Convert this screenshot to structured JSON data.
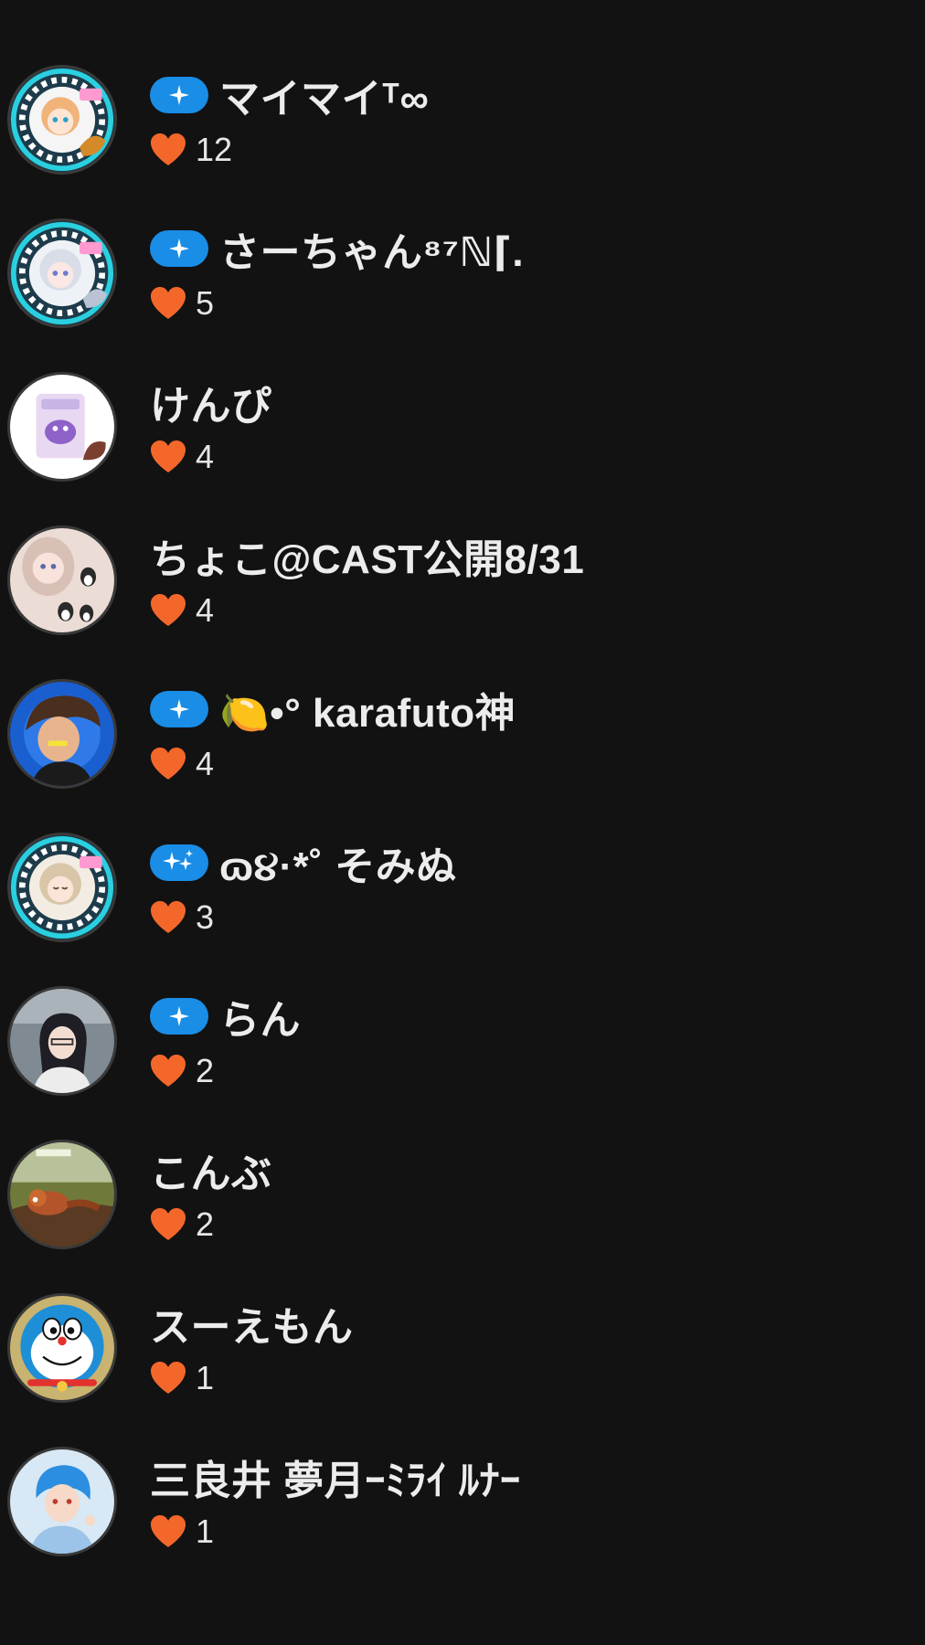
{
  "users": [
    {
      "name": "マイマイᵀ∞",
      "likes": "12",
      "badge": "sparkle",
      "avatar": "ticket-anime-girl-avatar"
    },
    {
      "name": "さーちゃん⁸⁷ℕ⌈.",
      "likes": "5",
      "badge": "sparkle",
      "avatar": "ticket-white-hair-girl-avatar"
    },
    {
      "name": "けんぴ",
      "likes": "4",
      "badge": "",
      "avatar": "snack-package-avatar"
    },
    {
      "name": "ちょこ@CAST公開8/31",
      "likes": "4",
      "badge": "",
      "avatar": "girl-with-penguins-avatar"
    },
    {
      "name": "🍋•° karafuto神",
      "likes": "4",
      "badge": "sparkle",
      "avatar": "anime-boy-avatar"
    },
    {
      "name": "ɷ૪·*˚ そみぬ",
      "likes": "3",
      "badge": "double-sparkle",
      "avatar": "ticket-sleepy-girl-avatar"
    },
    {
      "name": "らん",
      "likes": "2",
      "badge": "sparkle",
      "avatar": "dark-hair-girl-avatar"
    },
    {
      "name": "こんぶ",
      "likes": "2",
      "badge": "",
      "avatar": "red-panda-avatar"
    },
    {
      "name": "スーえもん",
      "likes": "1",
      "badge": "",
      "avatar": "doraemon-avatar"
    },
    {
      "name": "三良井 夢月ｰﾐﾗｲ ﾙﾅｰ",
      "likes": "1",
      "badge": "",
      "avatar": "blue-hair-boy-avatar"
    }
  ],
  "colors": {
    "background": "#121212",
    "badge": "#1a8de6",
    "heart": "#f4672b",
    "text": "#ececec"
  }
}
